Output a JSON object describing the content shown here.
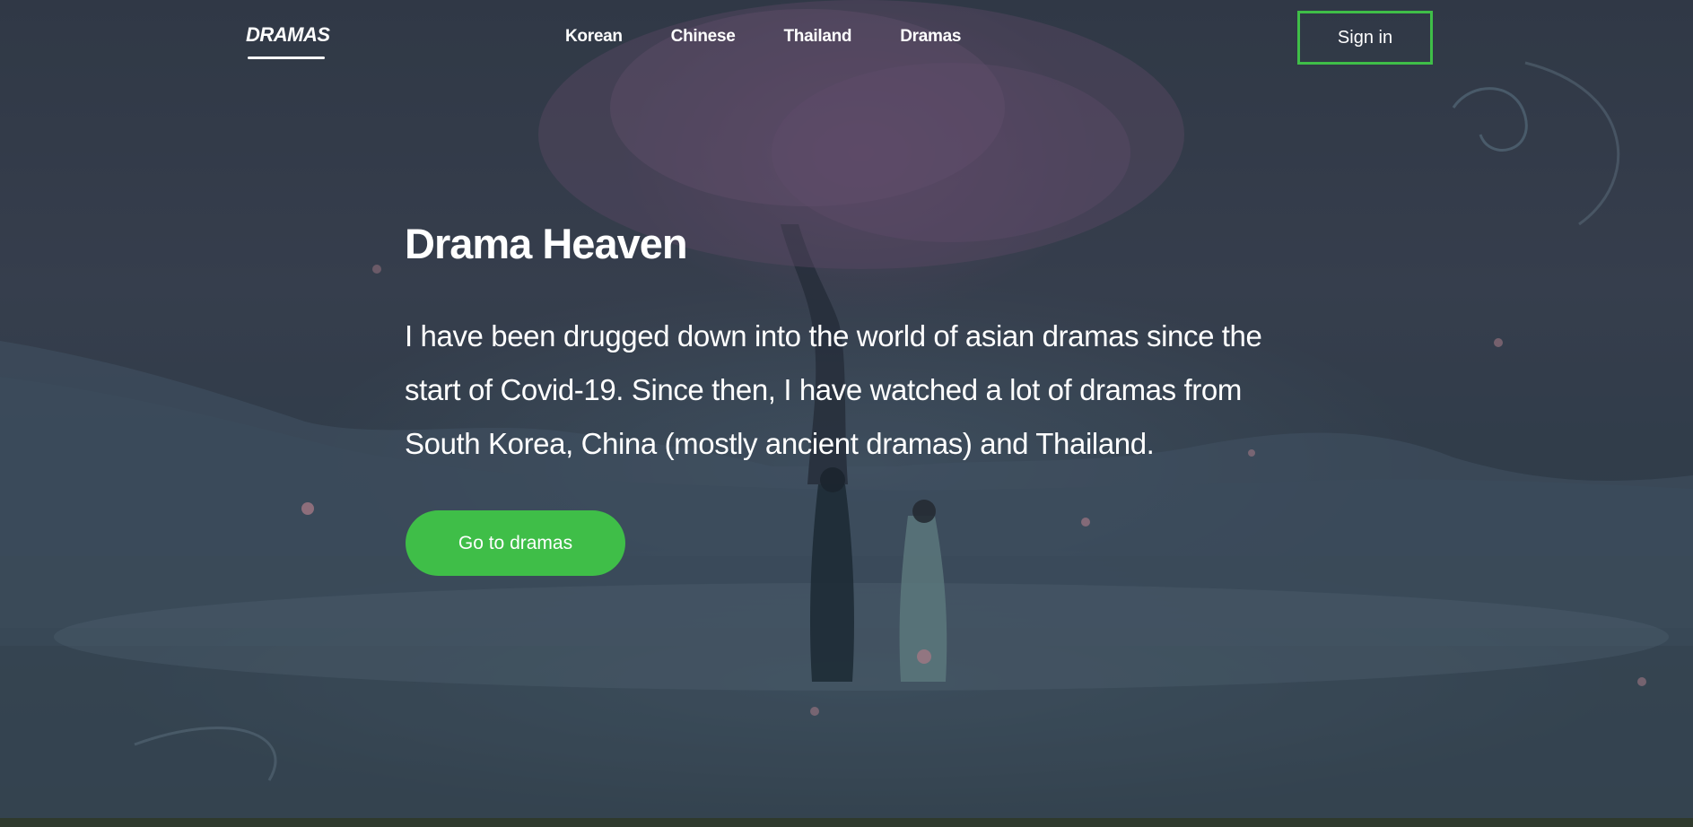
{
  "nav": {
    "logo": "DRAMAS",
    "links": [
      {
        "label": "Korean"
      },
      {
        "label": "Chinese"
      },
      {
        "label": "Thailand"
      },
      {
        "label": "Dramas"
      }
    ],
    "signin_label": "Sign in"
  },
  "hero": {
    "title": "Drama Heaven",
    "description": "I have been drugged down into the world of asian dramas since the start of Covid-19. Since then, I have watched a lot of dramas from South Korea, China (mostly ancient dramas) and Thailand.",
    "cta_label": "Go to dramas"
  },
  "colors": {
    "accent": "#3fbe48",
    "text": "#ffffff",
    "overlay": "#3b4352"
  }
}
